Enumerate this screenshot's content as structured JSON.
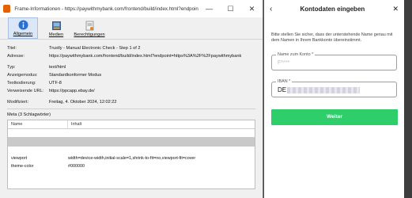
{
  "window": {
    "title": "Frame-Informationen - https://paywithmybank.com/frontend/build/index.html?endpoint=h...",
    "controls": {
      "minimize": "—",
      "maximize": "☐",
      "close": "✕"
    }
  },
  "tabs": [
    {
      "label": "Allgemein",
      "icon": "info-icon",
      "active": true
    },
    {
      "label": "Medien",
      "icon": "media-icon",
      "active": false
    },
    {
      "label": "Berechtigungen",
      "icon": "permissions-icon",
      "active": false
    }
  ],
  "info": {
    "title_k": "Titel:",
    "title_v": "Trustly - Manual Electronic Check - Step 1 of 2",
    "address_k": "Adresse:",
    "address_v": "https://paywithmybank.com/frontend/build/index.html?endpoint=https%3A%2F%2Fpaywithmybank",
    "type_k": "Typ:",
    "type_v": "text/html",
    "mode_k": "Anzeigemodus:",
    "mode_v": "Standardkonformer Modus",
    "encoding_k": "Textkodierung:",
    "encoding_v": "UTF-8",
    "ref_k": "Verweisende URL:",
    "ref_v": "https://ppcapp.ebay.de/",
    "modified_k": "Modifiziert:",
    "modified_v": "Freitag, 4. Oktober 2024, 12:02:22"
  },
  "meta": {
    "title": "Meta (3 Schlagwörter)",
    "col_name": "Name",
    "col_content": "Inhalt",
    "rows": [
      {
        "name": "viewport",
        "content": "width=device-width,initial-scale=1,shrink-to-fit=no,viewport-fit=cover"
      },
      {
        "name": "theme-color",
        "content": "#000000"
      }
    ]
  },
  "dialog": {
    "back": "‹",
    "title": "Kontodaten eingeben",
    "close": "✕",
    "description": "Bitte stellen Sie sicher, dass der unterstehende Name genau mit dem Namen in Ihrem Bankkonto übereinstimmt.",
    "name_label": "Name zum Konto *",
    "name_value": "F****",
    "iban_label": "IBAN *",
    "iban_prefix": "DE",
    "button": "Weiter"
  },
  "colors": {
    "accent": "#2ece6a",
    "selection": "#c9c9c9"
  }
}
